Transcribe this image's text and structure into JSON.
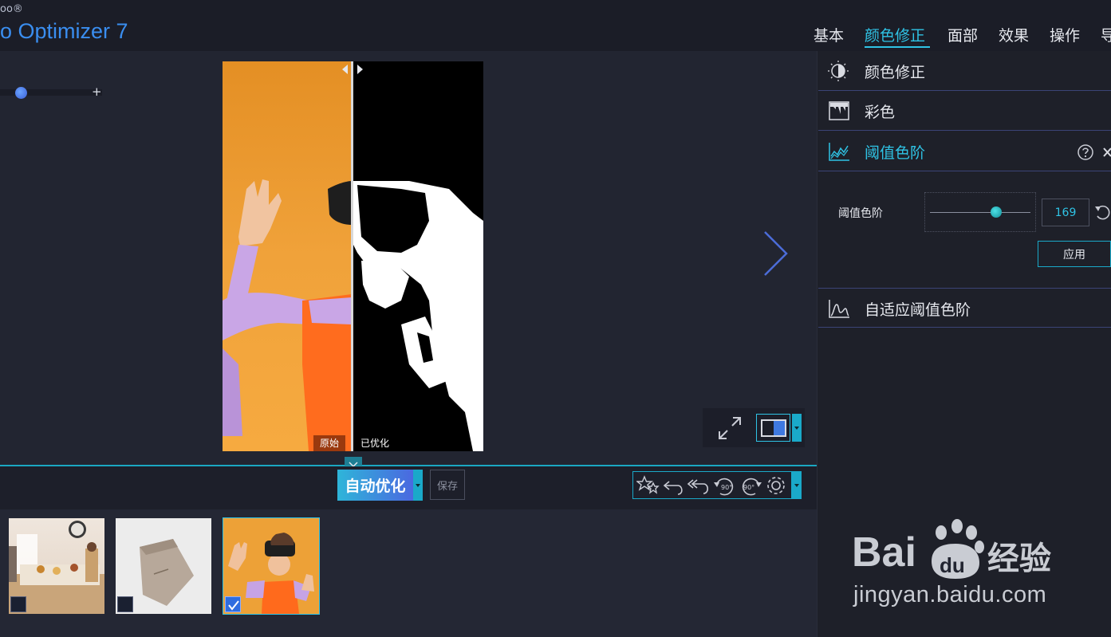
{
  "app": {
    "brand_small": "oo®",
    "brand_title": "o Optimizer 7"
  },
  "tabs": [
    {
      "label": "基本"
    },
    {
      "label": "颜色修正",
      "active": true
    },
    {
      "label": "面部"
    },
    {
      "label": "效果"
    },
    {
      "label": "操作"
    },
    {
      "label": "导"
    }
  ],
  "zoom": {
    "plus_label": "+",
    "level": 0.2
  },
  "preview": {
    "original_label": "原始",
    "optimized_label": "已优化"
  },
  "action_bar": {
    "auto_optimize_label": "自动优化",
    "save_label": "保存"
  },
  "filmstrip": {
    "items": [
      {
        "checked": false
      },
      {
        "checked": false
      },
      {
        "checked": true
      }
    ]
  },
  "panel": {
    "sections": [
      {
        "label": "颜色修正",
        "icon": "contrast-icon"
      },
      {
        "label": "彩色",
        "icon": "color-drip-icon"
      },
      {
        "label": "阈值色阶",
        "icon": "threshold-chart-icon",
        "expanded": true
      },
      {
        "label": "自适应阈值色阶",
        "icon": "adaptive-chart-icon"
      }
    ],
    "threshold": {
      "label": "阈值色阶",
      "value": "169",
      "level": 0.66,
      "apply_label": "应用"
    }
  },
  "watermark": {
    "logo_text": "Bai",
    "logo_text2": "du",
    "logo_cn": "经验",
    "url": "jingyan.baidu.com"
  },
  "colors": {
    "accent": "#2fc3e5",
    "brand": "#3a8ef0",
    "panel_border": "#3b4476"
  }
}
